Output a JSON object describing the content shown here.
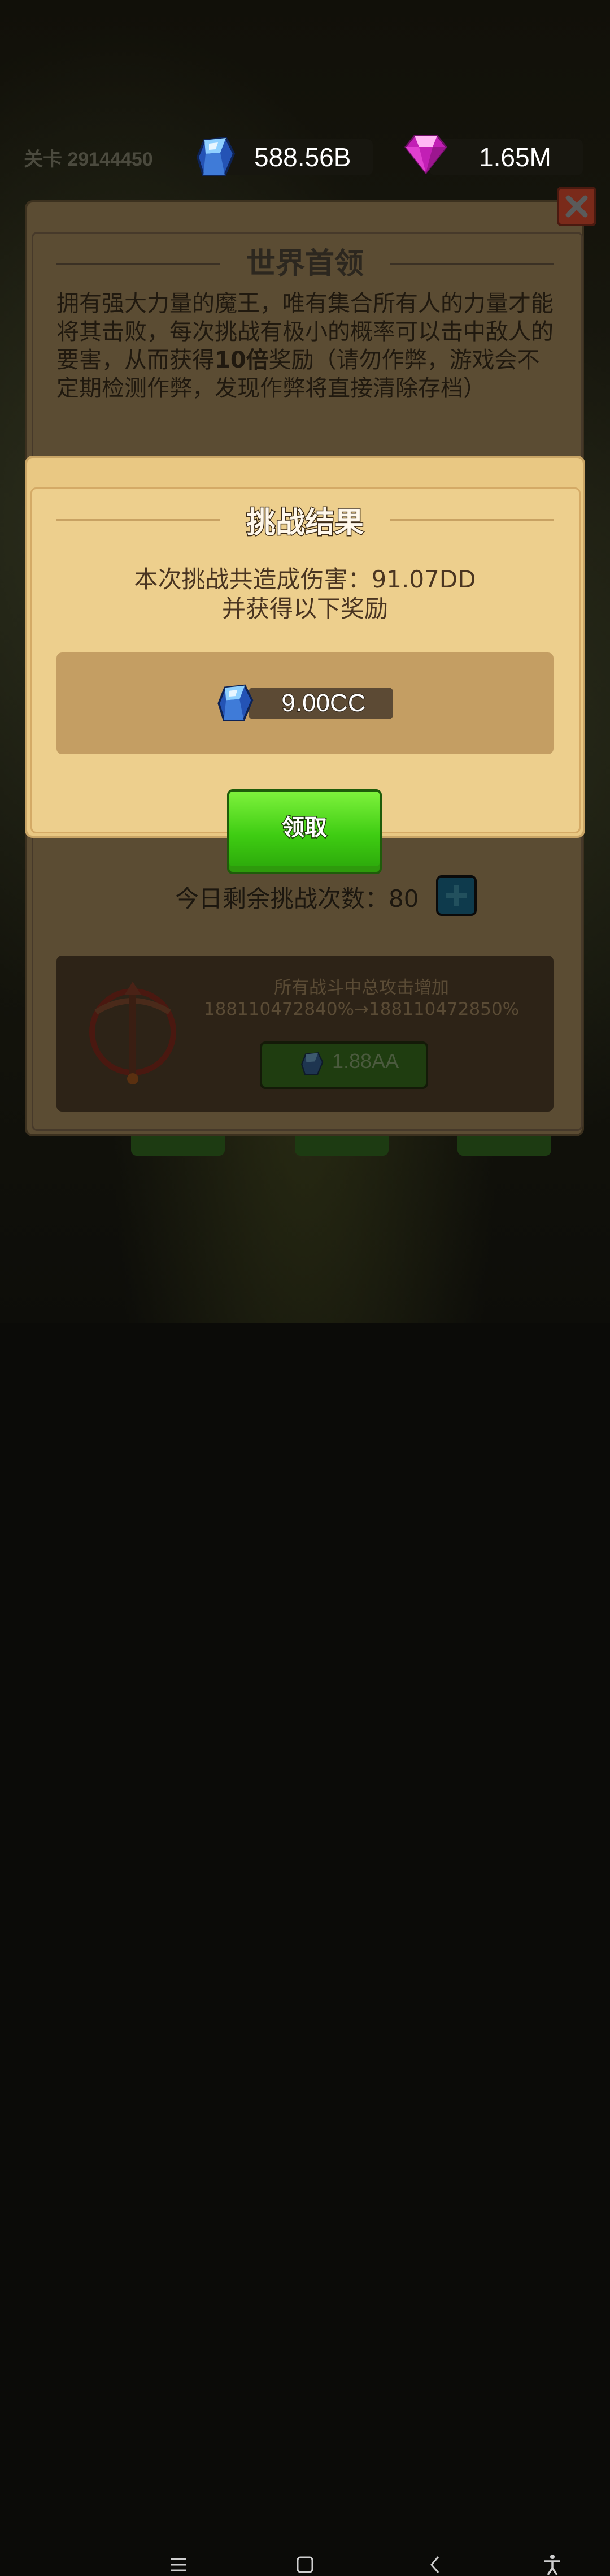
{
  "header": {
    "level_label": "关卡 29144450",
    "blue_gems": {
      "icon": "blue-gem-icon",
      "value": "588.56B"
    },
    "pink_gems": {
      "icon": "pink-diamond-icon",
      "value": "1.65M"
    }
  },
  "boss_panel": {
    "title": "世界首领",
    "description_parts": [
      "拥有强大力量的魔王，唯有集合所有人的力量才能将其击败，每次挑战有极小的概率可以击中敌人的要害，从而获得",
      "10倍",
      "奖励（请勿作弊，游戏会不定期检测作弊，发现作弊将直接清除存档）"
    ],
    "remaining_attempts_label": "今日剩余挑战次数：80",
    "upgrade": {
      "description_line1": "所有战斗中总攻击增加",
      "description_line2": "188110472840%→188110472850%",
      "cost": "1.88AA"
    }
  },
  "result_modal": {
    "title": "挑战结果",
    "damage_line": "本次挑战共造成伤害：91.07DD",
    "reward_line": "并获得以下奖励",
    "reward": {
      "icon": "blue-gem-icon",
      "amount": "9.00CC"
    },
    "claim_button": "领取"
  },
  "nav_bar": [
    "menu-icon",
    "home-square-icon",
    "back-chevron-icon",
    "accessibility-icon"
  ],
  "colors": {
    "modal_bg": "#e9c883",
    "claim_green": "#3ecc12",
    "blue_gem": "#3f7bd8",
    "pink_gem": "#e040d0"
  }
}
